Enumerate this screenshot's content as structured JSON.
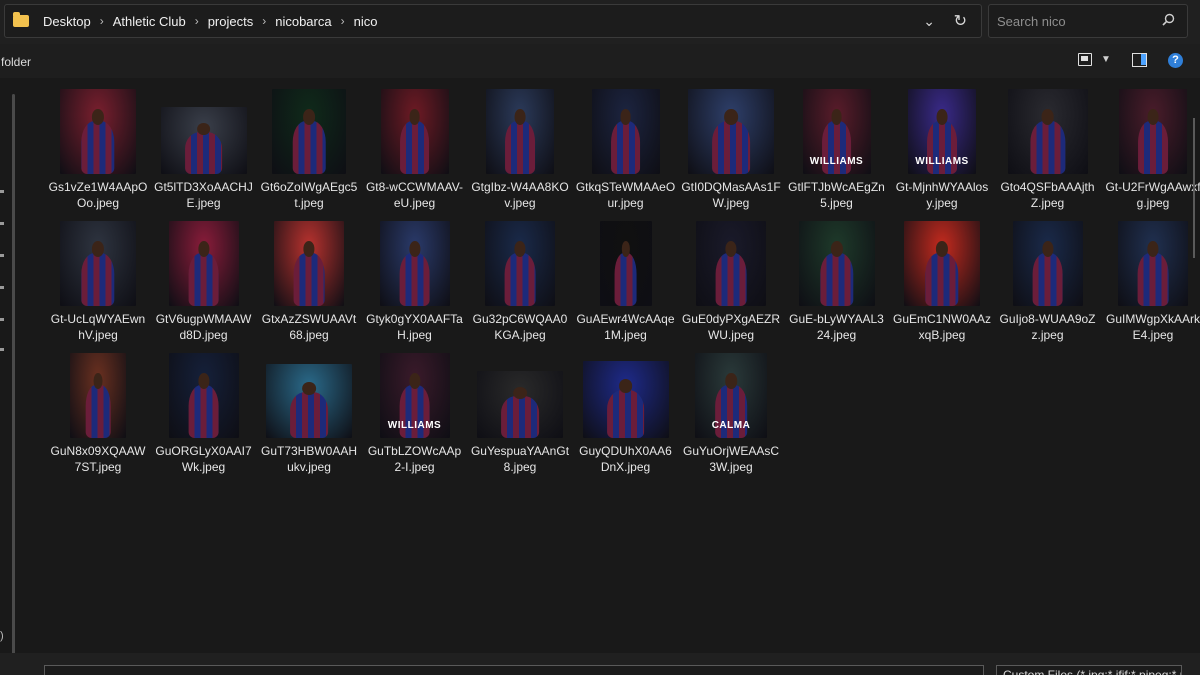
{
  "address": {
    "breadcrumbs": [
      "Desktop",
      "Athletic Club",
      "projects",
      "nicobarca",
      "nico"
    ]
  },
  "search": {
    "placeholder": "Search nico"
  },
  "toolbar": {
    "folder_label": "folder"
  },
  "files": [
    {
      "name": "Gs1vZe1W4AApOOo.jpeg",
      "w": 76,
      "h": 85,
      "bg": "#7a1f2e"
    },
    {
      "name": "Gt5lTD3XoAACHJE.jpeg",
      "w": 86,
      "h": 67,
      "bg": "#3a3f4a"
    },
    {
      "name": "Gt6oZoIWgAEgc5t.jpeg",
      "w": 74,
      "h": 85,
      "bg": "#0f2a1a"
    },
    {
      "name": "Gt8-wCCWMAAV-eU.jpeg",
      "w": 68,
      "h": 85,
      "bg": "#6e1a24"
    },
    {
      "name": "GtgIbz-W4AA8KOv.jpeg",
      "w": 68,
      "h": 85,
      "bg": "#2b3a5a"
    },
    {
      "name": "GtkqSTeWMAAeOur.jpeg",
      "w": 68,
      "h": 85,
      "bg": "#1c2440"
    },
    {
      "name": "GtI0DQMasAAs1FW.jpeg",
      "w": 86,
      "h": 85,
      "bg": "#2e3f6a"
    },
    {
      "name": "GtlFTJbWcAEgZn5.jpeg",
      "w": 68,
      "h": 85,
      "bg": "#5a1c2a",
      "caption": "WILLIAMS"
    },
    {
      "name": "Gt-MjnhWYAAlosy.jpeg",
      "w": 68,
      "h": 85,
      "bg": "#3a2a8a",
      "caption": "WILLIAMS"
    },
    {
      "name": "Gto4QSFbAAAjthZ.jpeg",
      "w": 80,
      "h": 85,
      "bg": "#2a2a30"
    },
    {
      "name": "Gt-U2FrWgAAwxfg.jpeg",
      "w": 68,
      "h": 85,
      "bg": "#4a1c2a"
    },
    {
      "name": "Gt-UcLqWYAEwnhV.jpeg",
      "w": 76,
      "h": 85,
      "bg": "#2e3440"
    },
    {
      "name": "GtV6ugpWMAAWd8D.jpeg",
      "w": 70,
      "h": 85,
      "bg": "#8a1c3a"
    },
    {
      "name": "GtxAzZSWUAAVt68.jpeg",
      "w": 70,
      "h": 85,
      "bg": "#b8322e"
    },
    {
      "name": "Gtyk0gYX0AAFTaH.jpeg",
      "w": 70,
      "h": 85,
      "bg": "#2a3a6a"
    },
    {
      "name": "Gu32pC6WQAA0KGA.jpeg",
      "w": 70,
      "h": 85,
      "bg": "#1a2a4a"
    },
    {
      "name": "GuAEwr4WcAAqe1M.jpeg",
      "w": 52,
      "h": 85,
      "bg": "#101010"
    },
    {
      "name": "GuE0dyPXgAEZRWU.jpeg",
      "w": 70,
      "h": 85,
      "bg": "#1a1a2a"
    },
    {
      "name": "GuE-bLyWYAAL324.jpeg",
      "w": 76,
      "h": 85,
      "bg": "#1e3a2a"
    },
    {
      "name": "GuEmC1NW0AAzxqB.jpeg",
      "w": 76,
      "h": 85,
      "bg": "#c42a1e"
    },
    {
      "name": "GuIjo8-WUAA9oZz.jpeg",
      "w": 70,
      "h": 85,
      "bg": "#1a2a4a"
    },
    {
      "name": "GuIMWgpXkAArkE4.jpeg",
      "w": 70,
      "h": 85,
      "bg": "#203050"
    },
    {
      "name": "GuN8x09XQAAW7ST.jpeg",
      "w": 56,
      "h": 85,
      "bg": "#6a3020"
    },
    {
      "name": "GuORGLyX0AAI7Wk.jpeg",
      "w": 70,
      "h": 85,
      "bg": "#15203a"
    },
    {
      "name": "GuT73HBW0AAHukv.jpeg",
      "w": 86,
      "h": 74,
      "bg": "#2a6a8a"
    },
    {
      "name": "GuTbLZOWcAAp2-I.jpeg",
      "w": 70,
      "h": 85,
      "bg": "#3a1a2a",
      "caption": "WILLIAMS"
    },
    {
      "name": "GuYespuaYAAnGt8.jpeg",
      "w": 86,
      "h": 67,
      "bg": "#2a2a2a"
    },
    {
      "name": "GuyQDUhX0AA6DnX.jpeg",
      "w": 86,
      "h": 77,
      "bg": "#1e2a8a"
    },
    {
      "name": "GuYuOrjWEAAsC3W.jpeg",
      "w": 72,
      "h": 85,
      "bg": "#2a3a3a",
      "caption": "CALMA"
    }
  ],
  "bottom": {
    "file_type": "Custom Files (*.jpg;*.jfif;*.pjpeg;*.pjp)"
  }
}
